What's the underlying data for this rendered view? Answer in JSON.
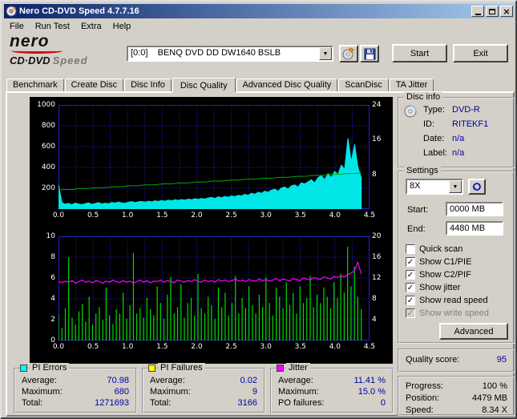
{
  "window": {
    "title": "Nero CD-DVD Speed 4.7.7.16"
  },
  "icons": {
    "dropdown": "▼",
    "close": "×",
    "check": "✓"
  },
  "menu": [
    "File",
    "Run Test",
    "Extra",
    "Help"
  ],
  "logo": {
    "brand": "nero",
    "product": "CD·DVD",
    "speed": "Speed"
  },
  "toolbar": {
    "drive": "[0:0]    BENQ DVD DD DW1640 BSLB",
    "start": "Start",
    "exit": "Exit"
  },
  "tabs": [
    {
      "label": "Benchmark"
    },
    {
      "label": "Create Disc"
    },
    {
      "label": "Disc Info"
    },
    {
      "label": "Disc Quality",
      "active": true
    },
    {
      "label": "Advanced Disc Quality"
    },
    {
      "label": "ScanDisc"
    },
    {
      "label": "TA Jitter"
    }
  ],
  "disc_info": {
    "title": "Disc info",
    "rows": [
      {
        "label": "Type:",
        "value": "DVD-R"
      },
      {
        "label": "ID:",
        "value": "RITEKF1"
      },
      {
        "label": "Date:",
        "value": "n/a"
      },
      {
        "label": "Label:",
        "value": "n/a"
      }
    ]
  },
  "settings": {
    "title": "Settings",
    "speed": "8X",
    "start_label": "Start:",
    "start_value": "0000 MB",
    "end_label": "End:",
    "end_value": "4480 MB",
    "advanced": "Advanced",
    "checkboxes": [
      {
        "label": "Quick scan",
        "checked": false
      },
      {
        "label": "Show C1/PIE",
        "checked": true
      },
      {
        "label": "Show C2/PIF",
        "checked": true
      },
      {
        "label": "Show jitter",
        "checked": true
      },
      {
        "label": "Show read speed",
        "checked": true
      },
      {
        "label": "Show write speed",
        "checked": true,
        "disabled": true
      }
    ]
  },
  "quality": {
    "label": "Quality score:",
    "value": "95"
  },
  "progress": {
    "rows": [
      {
        "label": "Progress:",
        "value": "100 %"
      },
      {
        "label": "Position:",
        "value": "4479 MB"
      },
      {
        "label": "Speed:",
        "value": "8.34 X"
      }
    ]
  },
  "stats": [
    {
      "title": "PI Errors",
      "color": "#00ffff",
      "rows": [
        {
          "label": "Average:",
          "value": "70.98"
        },
        {
          "label": "Maximum:",
          "value": "680"
        },
        {
          "label": "Total:",
          "value": "1271693"
        }
      ]
    },
    {
      "title": "PI Failures",
      "color": "#ffff00",
      "rows": [
        {
          "label": "Average:",
          "value": "0.02"
        },
        {
          "label": "Maximum:",
          "value": "9"
        },
        {
          "label": "Total:",
          "value": "3166"
        }
      ]
    },
    {
      "title": "Jitter",
      "color": "#ff00ff",
      "rows": [
        {
          "label": "Average:",
          "value": "11.41 %"
        },
        {
          "label": "Maximum:",
          "value": "15.0 %"
        },
        {
          "label": "PO failures:",
          "value": "0"
        }
      ]
    }
  ],
  "chart_data": [
    {
      "name": "pie-chart",
      "type": "area",
      "x_ticks": [
        "0.0",
        "0.5",
        "1.0",
        "1.5",
        "2.0",
        "2.5",
        "3.0",
        "3.5",
        "4.0",
        "4.5"
      ],
      "x_max_axis": 4.5,
      "x_max_data": 4.38,
      "grid": {
        "v": 18,
        "h": 5
      },
      "grid_color": "#2222c2",
      "left_axis": {
        "max": 1000,
        "ticks": [
          "1000",
          "800",
          "600",
          "400",
          "200"
        ],
        "fractions": [
          0,
          0.2,
          0.4,
          0.6,
          0.8
        ]
      },
      "right_axis": {
        "max": 24,
        "ticks": [
          "24",
          "16",
          "8"
        ],
        "fractions": [
          0,
          0.3333,
          0.6667
        ]
      },
      "series": [
        {
          "name": "PI Errors",
          "kind": "area",
          "axis": "left",
          "color": "#00e6e6",
          "values": [
            235,
            62,
            48,
            55,
            42,
            58,
            50,
            44,
            52,
            60,
            46,
            54,
            62,
            50,
            57,
            52,
            64,
            58,
            68,
            60,
            56,
            66,
            72,
            62,
            70,
            74,
            66,
            76,
            70,
            80,
            74,
            82,
            76,
            86,
            80,
            90,
            84,
            92,
            86,
            96,
            90,
            100,
            94,
            102,
            96,
            108,
            112,
            102,
            118,
            110,
            122,
            114,
            128,
            120,
            132,
            126,
            142,
            132,
            152,
            142,
            162,
            152,
            172,
            162,
            182,
            192,
            172,
            202,
            212,
            192,
            222,
            232,
            212,
            252,
            242,
            262,
            282,
            252,
            302,
            322,
            282,
            342,
            302,
            362,
            332,
            422,
            382,
            680,
            452,
            622,
            402,
            302
          ]
        },
        {
          "name": "Read speed",
          "kind": "trend",
          "axis": "right",
          "color": "#00a800",
          "start": 4.4,
          "end": 8.34
        }
      ]
    },
    {
      "name": "pif-chart",
      "type": "bar",
      "x_ticks": [
        "0.0",
        "0.5",
        "1.0",
        "1.5",
        "2.0",
        "2.5",
        "3.0",
        "3.5",
        "4.0",
        "4.5"
      ],
      "x_max_axis": 4.5,
      "x_max_data": 4.38,
      "grid": {
        "v": 18,
        "h": 5
      },
      "grid_color": "#2222c2",
      "left_axis": {
        "max": 10,
        "ticks": [
          "10",
          "8",
          "6",
          "4",
          "2",
          "0"
        ],
        "fractions": [
          0,
          0.2,
          0.4,
          0.6,
          0.8,
          1
        ]
      },
      "right_axis": {
        "max": 20,
        "ticks": [
          "20",
          "16",
          "12",
          "8",
          "4"
        ],
        "fractions": [
          0,
          0.2,
          0.4,
          0.6,
          0.8
        ]
      },
      "series": [
        {
          "name": "PI Failures",
          "kind": "bars",
          "axis": "left",
          "color": "#00dc00",
          "values": [
            2.5,
            1.2,
            3.1,
            8.0,
            2.2,
            1.5,
            2.8,
            3.5,
            1.8,
            4.2,
            1.5,
            2.6,
            3.2,
            2.0,
            5.1,
            2.4,
            1.6,
            3.0,
            2.6,
            4.6,
            2.1,
            3.4,
            8.4,
            2.6,
            3.1,
            2.2,
            4.1,
            3.0,
            2.4,
            5.2,
            3.6,
            2.1,
            4.4,
            6.1,
            2.6,
            3.2,
            5.4,
            2.2,
            3.6,
            4.1,
            2.4,
            6.4,
            3.1,
            2.6,
            4.2,
            3.4,
            2.1,
            5.1,
            3.2,
            4.6,
            2.4,
            3.6,
            6.2,
            2.6,
            4.1,
            3.1,
            5.2,
            3.4,
            2.6,
            4.4,
            3.2,
            6.1,
            3.6,
            2.4,
            5.1,
            4.2,
            3.1,
            5.6,
            3.4,
            4.6,
            2.6,
            5.2,
            3.6,
            4.1,
            6.2,
            3.2,
            4.4,
            3.6,
            5.1,
            4.2,
            3.1,
            5.6,
            4.1,
            6.4,
            4.6,
            9.0,
            5.2,
            7.1,
            4.2,
            3.0
          ]
        },
        {
          "name": "Jitter",
          "kind": "line",
          "axis": "right",
          "color": "#ff00ff",
          "values": [
            11.3,
            11.1,
            11.4,
            11.2,
            11.5,
            11.0,
            11.3,
            11.6,
            11.2,
            11.4,
            11.1,
            11.5,
            11.3,
            11.0,
            11.4,
            11.2,
            11.6,
            11.3,
            11.1,
            11.5,
            11.2,
            11.4,
            11.0,
            11.3,
            11.6,
            11.2,
            11.5,
            11.1,
            11.4,
            11.3,
            11.6,
            11.2,
            11.5,
            11.3,
            11.1,
            11.6,
            11.4,
            11.2,
            11.5,
            11.3,
            11.7,
            11.4,
            11.2,
            11.6,
            11.3,
            11.5,
            11.2,
            11.7,
            11.4,
            11.6,
            11.3,
            11.5,
            11.8,
            11.4,
            11.6,
            11.3,
            11.7,
            11.5,
            11.4,
            11.8,
            11.5,
            11.7,
            11.4,
            11.6,
            11.9,
            11.5,
            11.8,
            11.6,
            11.4,
            11.9,
            11.7,
            11.5,
            12.0,
            11.8,
            11.6,
            12.1,
            11.9,
            11.7,
            12.2,
            12.0,
            11.8,
            12.3,
            12.1,
            12.4,
            12.2,
            12.6,
            12.9,
            13.4,
            15.0,
            12.8
          ]
        }
      ]
    }
  ]
}
